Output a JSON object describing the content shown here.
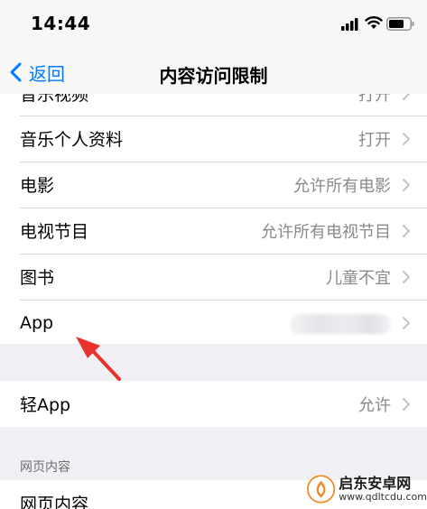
{
  "status_bar": {
    "time": "14:44"
  },
  "nav": {
    "back_label": "返回",
    "title": "内容访问限制"
  },
  "rows": [
    {
      "label": "音乐视频",
      "value": "打开"
    },
    {
      "label": "音乐个人资料",
      "value": "打开"
    },
    {
      "label": "电影",
      "value": "允许所有电影"
    },
    {
      "label": "电视节目",
      "value": "允许所有电视节目"
    },
    {
      "label": "图书",
      "value": "儿童不宜"
    },
    {
      "label": "App",
      "value": ""
    }
  ],
  "light_app": {
    "label": "轻App",
    "value": "允许"
  },
  "web_section": {
    "header": "网页内容",
    "row_label": "网页内容"
  },
  "watermark": {
    "name": "启东安卓网",
    "url": "www.qdltcdu.com"
  },
  "colors": {
    "accent": "#007aff",
    "arrow": "#e8322c",
    "secondary_text": "#8a8a8e"
  }
}
